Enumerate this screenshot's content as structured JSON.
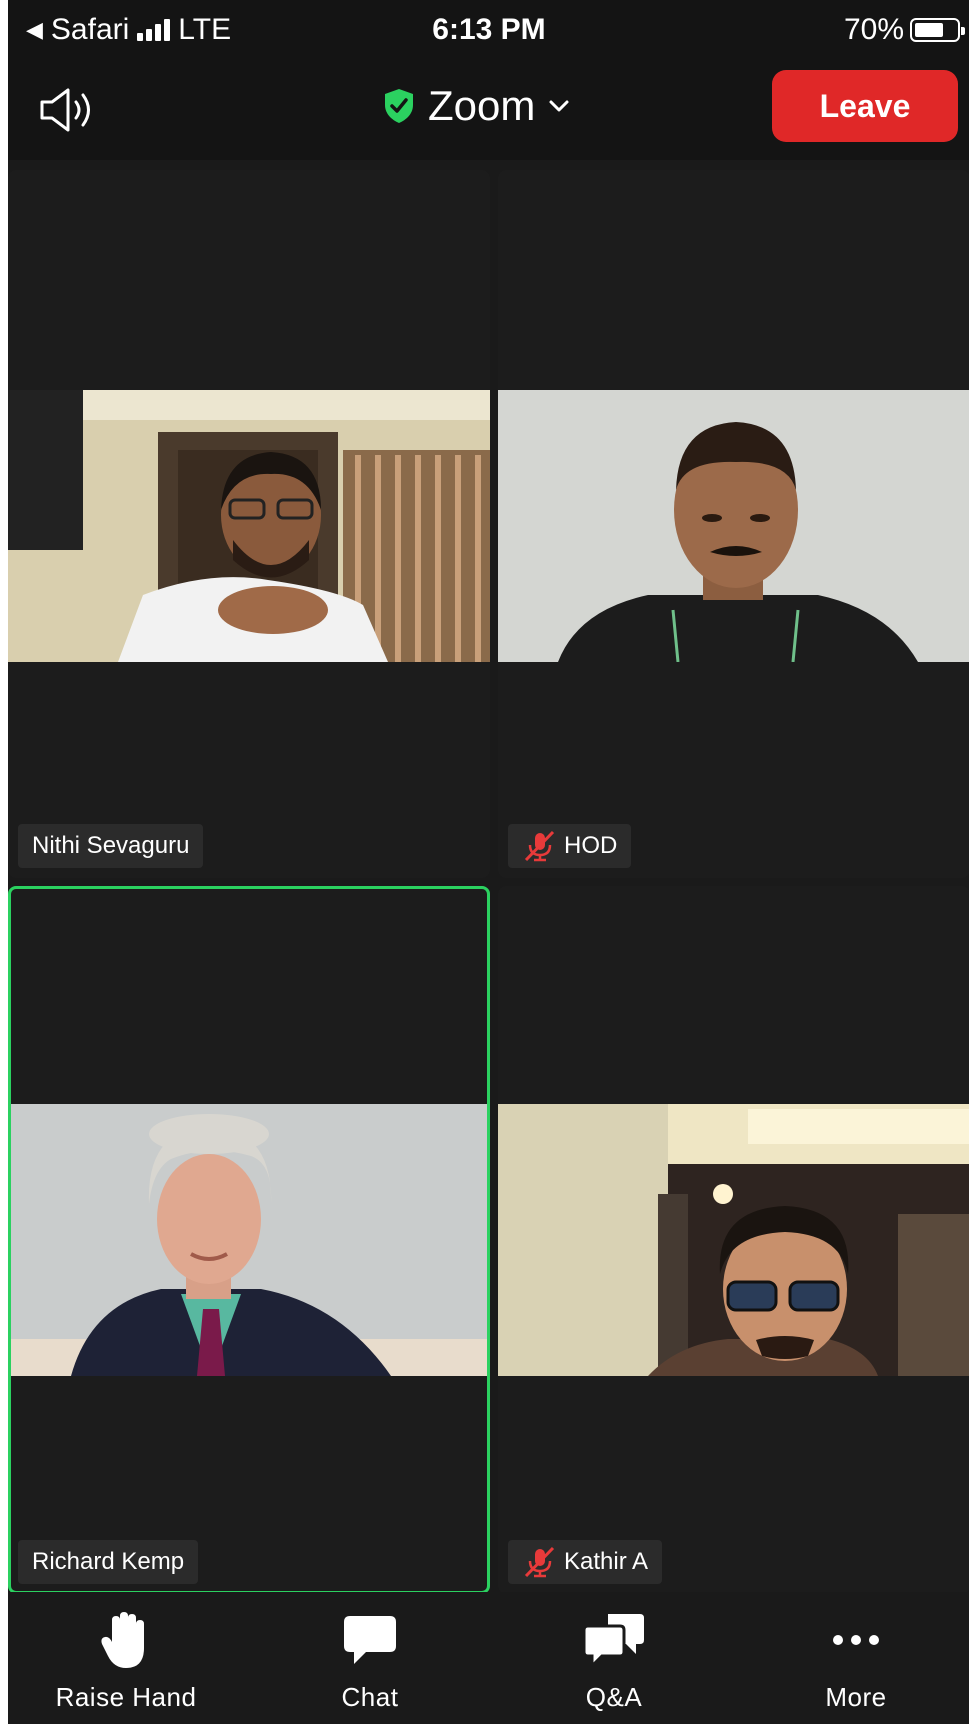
{
  "status_bar": {
    "back_app": "Safari",
    "network": "LTE",
    "time": "6:13 PM",
    "battery": "70%",
    "battery_level": 0.7
  },
  "header": {
    "title": "Zoom",
    "leave_label": "Leave",
    "accent_colors": {
      "secure": "#2bd160",
      "leave": "#e02828",
      "active_speaker": "#2bd160"
    }
  },
  "participants": [
    {
      "name": "Nithi Sevaguru",
      "muted": false,
      "active": false
    },
    {
      "name": "HOD",
      "muted": true,
      "active": false
    },
    {
      "name": "Richard Kemp",
      "muted": false,
      "active": true
    },
    {
      "name": "Kathir A",
      "muted": true,
      "active": false
    }
  ],
  "toolbar": {
    "items": [
      {
        "label": "Raise Hand",
        "icon": "raise-hand-icon"
      },
      {
        "label": "Chat",
        "icon": "chat-icon"
      },
      {
        "label": "Q&A",
        "icon": "qa-icon"
      },
      {
        "label": "More",
        "icon": "more-icon"
      }
    ]
  }
}
